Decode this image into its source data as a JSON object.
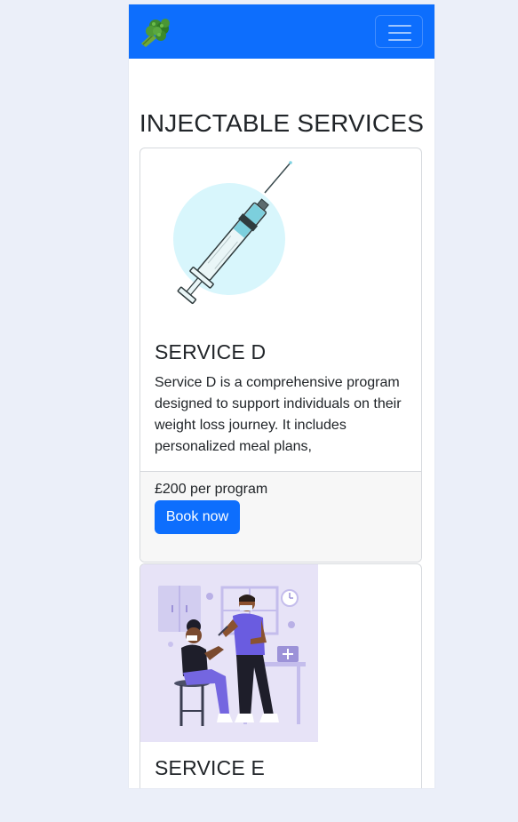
{
  "navbar": {
    "brand_icon": "broccoli-icon",
    "toggler_icon": "hamburger-menu-icon",
    "bg_color": "#0d6efd"
  },
  "page": {
    "title": "INJECTABLE SERVICES"
  },
  "services": [
    {
      "image_icon": "syringe-illustration",
      "title": "SERVICE D",
      "description": "Service D is a comprehensive program designed to support individuals on their weight loss journey. It includes personalized meal plans,",
      "price": "£200 per program",
      "button_label": "Book now"
    },
    {
      "image_icon": "nurse-vaccinating-patient-illustration",
      "title": "SERVICE E"
    }
  ]
}
